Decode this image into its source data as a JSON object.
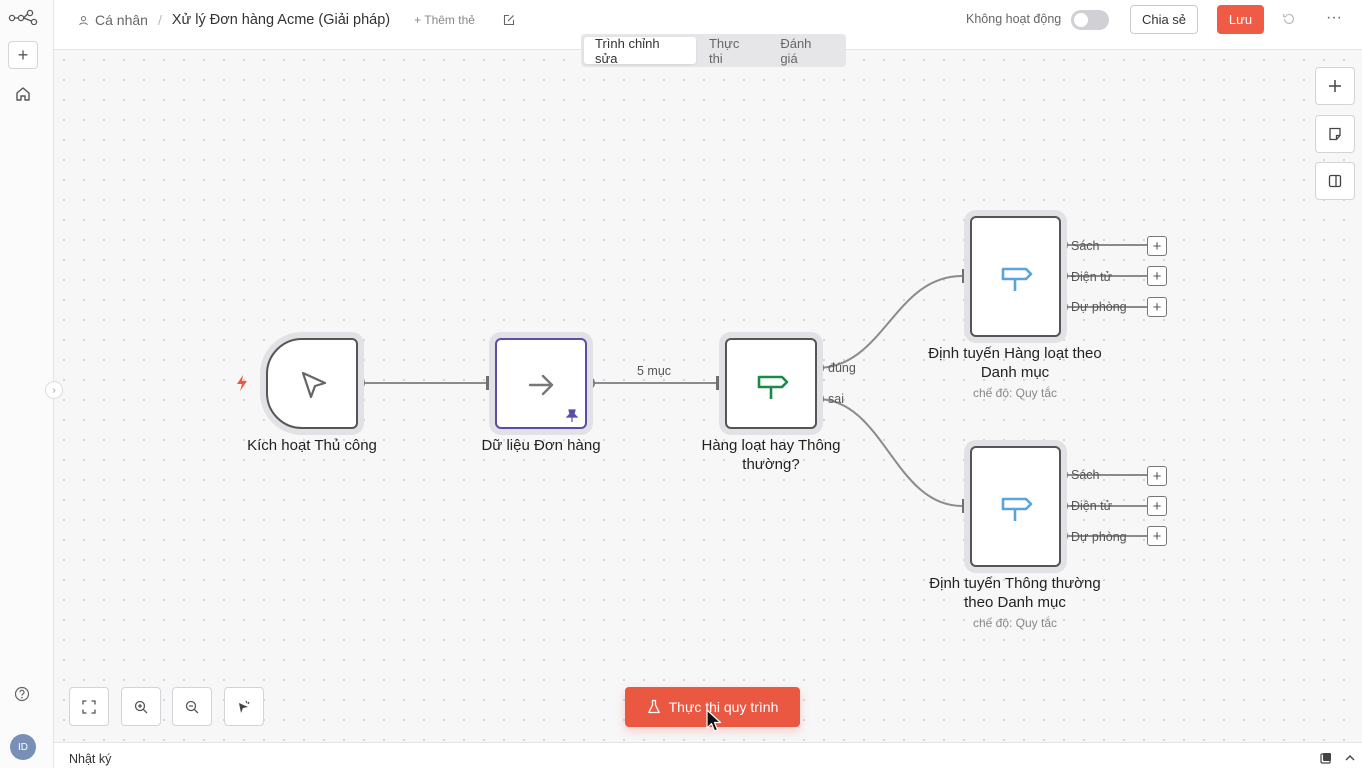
{
  "sidebar": {
    "avatar_initials": "ID"
  },
  "header": {
    "breadcrumb_owner": "Cá nhân",
    "workflow_title": "Xử lý Đơn hàng Acme (Giải pháp)",
    "add_tag": "+ Thêm thẻ",
    "status_label": "Không hoạt động",
    "share": "Chia sẻ",
    "save": "Lưu"
  },
  "tabs": [
    {
      "label": "Trình chỉnh sửa",
      "active": true
    },
    {
      "label": "Thực thi",
      "active": false
    },
    {
      "label": "Đánh giá",
      "active": false
    }
  ],
  "nodes": {
    "trigger": {
      "label": "Kích hoạt Thủ công"
    },
    "order_data": {
      "label": "Dữ liệu Đơn hàng"
    },
    "bulk_check": {
      "label": "Hàng loạt hay Thông thường?",
      "out_true": "đúng",
      "out_false": "sai"
    },
    "route_bulk": {
      "label": "Định tuyến Hàng loạt theo Danh mục",
      "subtitle": "chế độ: Quy tắc",
      "outputs": [
        "Sách",
        "Điện tử",
        "Dự phòng"
      ]
    },
    "route_regular": {
      "label": "Định tuyến Thông thường theo Danh mục",
      "subtitle": "chế độ: Quy tắc",
      "outputs": [
        "Sách",
        "Điện tử",
        "Dự phòng"
      ]
    }
  },
  "edges": {
    "items_label": "5 mục"
  },
  "run_button": "Thực thi quy trình",
  "log_panel": {
    "label": "Nhật ký"
  },
  "colors": {
    "accent": "#ea5842",
    "switch_green": "#1a8a4a",
    "switch_blue": "#5ba3d9",
    "pinned_purple": "#5b4ea8"
  }
}
